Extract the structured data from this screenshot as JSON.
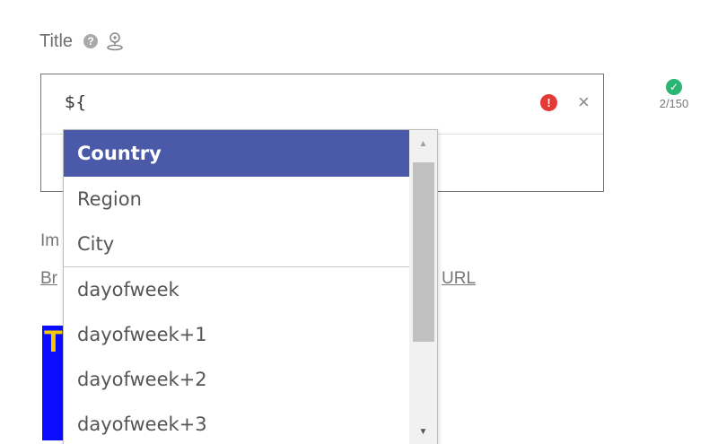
{
  "title_field": {
    "label": "Title",
    "input_value": "${",
    "counter": "2/150"
  },
  "background": {
    "label_partial": "Im",
    "link_left_partial": "Br",
    "link_right_partial": "URL",
    "image_letter": "T"
  },
  "dropdown": {
    "items": [
      {
        "label": "Country",
        "selected": true
      },
      {
        "label": "Region",
        "selected": false
      },
      {
        "label": "City",
        "selected": false
      },
      {
        "label": "dayofweek",
        "selected": false
      },
      {
        "label": "dayofweek+1",
        "selected": false
      },
      {
        "label": "dayofweek+2",
        "selected": false
      },
      {
        "label": "dayofweek+3",
        "selected": false
      }
    ]
  },
  "icons": {
    "help": "help-icon",
    "pin": "location-pin-icon",
    "error": "error-icon",
    "clear": "close-icon",
    "check": "check-icon"
  },
  "colors": {
    "selected_bg": "#4a5aa8",
    "error": "#e53935",
    "success": "#2bb573"
  }
}
